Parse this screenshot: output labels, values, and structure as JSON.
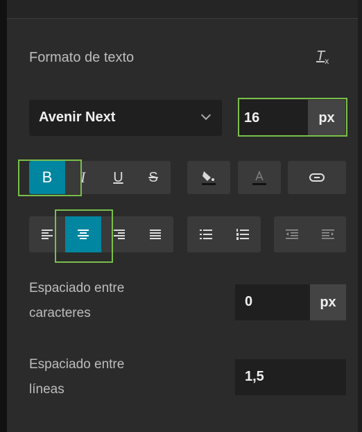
{
  "section": {
    "title": "Formato de texto",
    "clear_format_icon": "clear-format-icon"
  },
  "font": {
    "family": "Avenir Next",
    "size": "16",
    "size_unit": "px"
  },
  "style_buttons": [
    {
      "name": "bold",
      "glyph": "B",
      "active": true
    },
    {
      "name": "italic",
      "glyph": "I",
      "active": false
    },
    {
      "name": "underline",
      "glyph": "U",
      "active": false
    },
    {
      "name": "strikethrough",
      "glyph": "S",
      "active": false
    }
  ],
  "alignment_buttons": [
    {
      "name": "align-left",
      "active": false
    },
    {
      "name": "align-center",
      "active": true
    },
    {
      "name": "align-right",
      "active": false
    },
    {
      "name": "justify",
      "active": false
    }
  ],
  "letter_spacing": {
    "label_line1": "Espaciado entre",
    "label_line2": "caracteres",
    "value": "0",
    "unit": "px"
  },
  "line_spacing": {
    "label_line1": "Espaciado entre",
    "label_line2": "líneas",
    "value": "1,5"
  },
  "colors": {
    "accent": "#0086a0",
    "highlight_outline": "#79c04a",
    "panel": "#2b2b2b",
    "input": "#1f1f1f",
    "button": "#3a3a3a"
  }
}
